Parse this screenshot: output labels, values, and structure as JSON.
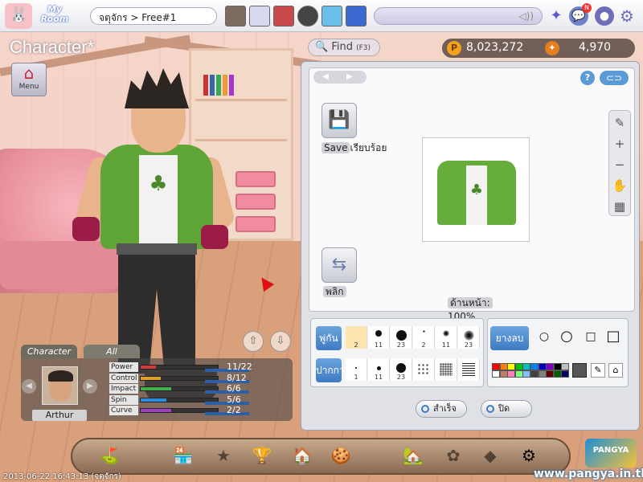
{
  "topbar": {
    "myroom_line1": "My",
    "myroom_line2": "Room",
    "room_label": "จตุจักร > Free#1",
    "speaker_glyph": "◁))",
    "notification_badge": "N"
  },
  "left": {
    "title": "Character",
    "title_star": "*",
    "menu_label": "Menu",
    "tabs": [
      "Character",
      "All"
    ],
    "player_name": "Arthur",
    "stats": [
      {
        "label": "Power",
        "value": "11/22",
        "level": 0.5,
        "color": "#d33a3a"
      },
      {
        "label": "Control",
        "value": "8/12",
        "level": 0.66,
        "color": "#e0a020"
      },
      {
        "label": "Impact",
        "value": "6/6",
        "level": 1.0,
        "color": "#3fb04a"
      },
      {
        "label": "Spin",
        "value": "5/6",
        "level": 0.83,
        "color": "#2a8de0"
      },
      {
        "label": "Curve",
        "value": "2/2",
        "level": 1.0,
        "color": "#a040c0"
      }
    ]
  },
  "find": {
    "label": "Find",
    "shortcut": "(F3)"
  },
  "currency": {
    "pang": "8,023,272",
    "cookie": "4,970",
    "pang_icon": "P",
    "cookie_icon": "✦"
  },
  "editor": {
    "save_label": "Save",
    "save_status": "เรียบร้อย",
    "flip_label": "พลิก",
    "zoom_label": "ด้านหน้า:",
    "zoom_value": "100%",
    "help": "?",
    "link": "⊂⊃",
    "brush_label": "พู่กัน",
    "eraser_label": "ยางลบ",
    "pen_label": "ปากกา",
    "brush_sizes": [
      "2",
      "11",
      "23",
      "2",
      "11",
      "23"
    ],
    "pen_sizes": [
      "1",
      "11",
      "23"
    ],
    "ok_label": "สำเร็จ",
    "close_label": "ปิด",
    "palette": [
      "#ff0000",
      "#ff8000",
      "#ffff00",
      "#00c000",
      "#00c0c0",
      "#0080ff",
      "#0000c0",
      "#8000c0",
      "#000000",
      "#c0c0c0",
      "#ffffff",
      "#c08060",
      "#ff80c0",
      "#80ff80",
      "#80c0ff",
      "#404040",
      "#808080",
      "#600000",
      "#006000",
      "#000060"
    ]
  },
  "bottom": {
    "timestamp": "2013-06-22 16:43:13 (จตุจักร)",
    "website": "www.pangya.in.th",
    "brand": "PANGYA"
  }
}
